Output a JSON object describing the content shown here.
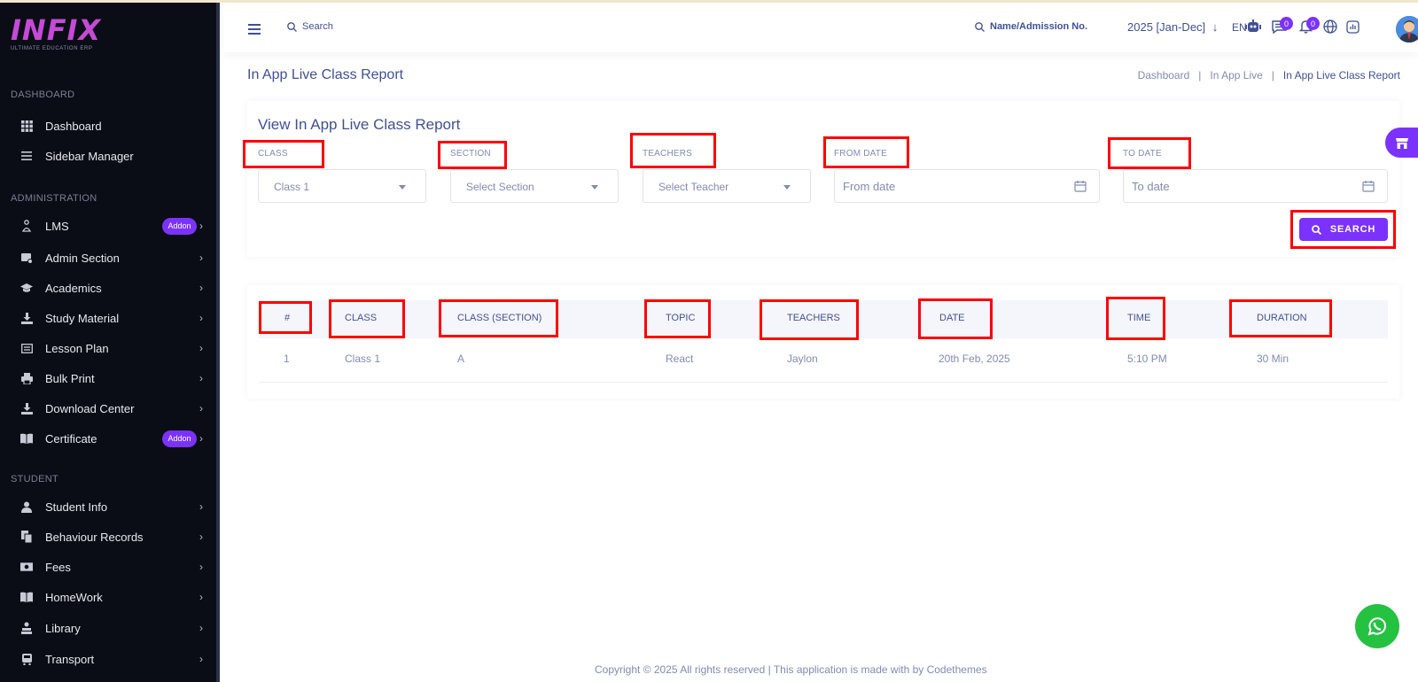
{
  "sidebar": {
    "logo_text": "INFIX",
    "logo_sub": "ULTIMATE EDUCATION ERP",
    "sections": [
      "DASHBOARD",
      "ADMINISTRATION",
      "STUDENT"
    ],
    "items": [
      {
        "label": "Dashboard",
        "icon": "grid-icon"
      },
      {
        "label": "Sidebar Manager",
        "icon": "list-icon"
      },
      {
        "label": "LMS",
        "icon": "lms-icon",
        "badge": "Addon"
      },
      {
        "label": "Admin Section",
        "icon": "admin-icon"
      },
      {
        "label": "Academics",
        "icon": "mortarboard-icon"
      },
      {
        "label": "Study Material",
        "icon": "download-icon"
      },
      {
        "label": "Lesson Plan",
        "icon": "lesson-icon"
      },
      {
        "label": "Bulk Print",
        "icon": "printer-icon"
      },
      {
        "label": "Download Center",
        "icon": "download-icon"
      },
      {
        "label": "Certificate",
        "icon": "book-icon",
        "badge": "Addon"
      },
      {
        "label": "Student Info",
        "icon": "user-icon"
      },
      {
        "label": "Behaviour Records",
        "icon": "copy-icon"
      },
      {
        "label": "Fees",
        "icon": "money-icon"
      },
      {
        "label": "HomeWork",
        "icon": "book-icon"
      },
      {
        "label": "Library",
        "icon": "library-icon"
      },
      {
        "label": "Transport",
        "icon": "bus-icon"
      }
    ]
  },
  "header": {
    "search_label": "Search",
    "name_search_label": "Name/Admission No.",
    "year": "2025 [Jan-Dec]",
    "language": "EN",
    "message_count": "0",
    "notification_count": "0"
  },
  "page": {
    "title": "In App Live Class Report",
    "breadcrumb": [
      "Dashboard",
      "In App Live",
      "In App Live Class Report"
    ],
    "breadcrumb_sep": "|"
  },
  "filter": {
    "title": "View In App Live Class Report",
    "class_label": "CLASS",
    "class_value": "Class 1",
    "section_label": "SECTION",
    "section_placeholder": "Select Section",
    "teachers_label": "TEACHERS",
    "teachers_placeholder": "Select Teacher",
    "from_label": "FROM DATE",
    "from_placeholder": "From date",
    "to_label": "TO DATE",
    "to_placeholder": "To date",
    "search_button": "SEARCH"
  },
  "table": {
    "headers": [
      "#",
      "CLASS",
      "CLASS (SECTION)",
      "TOPIC",
      "TEACHERS",
      "DATE",
      "TIME",
      "DURATION"
    ],
    "rows": [
      [
        "1",
        "Class 1",
        "A",
        "React",
        "Jaylon",
        "20th Feb, 2025",
        "5:10 PM",
        "30 Min"
      ]
    ]
  },
  "footer": {
    "text": "Copyright © 2025 All rights reserved | This application is made with by Codethemes"
  },
  "colors": {
    "accent": "#7c32ff",
    "sidebar_bg": "#0b0d16",
    "text_primary": "#415094",
    "whatsapp": "#25c242"
  }
}
